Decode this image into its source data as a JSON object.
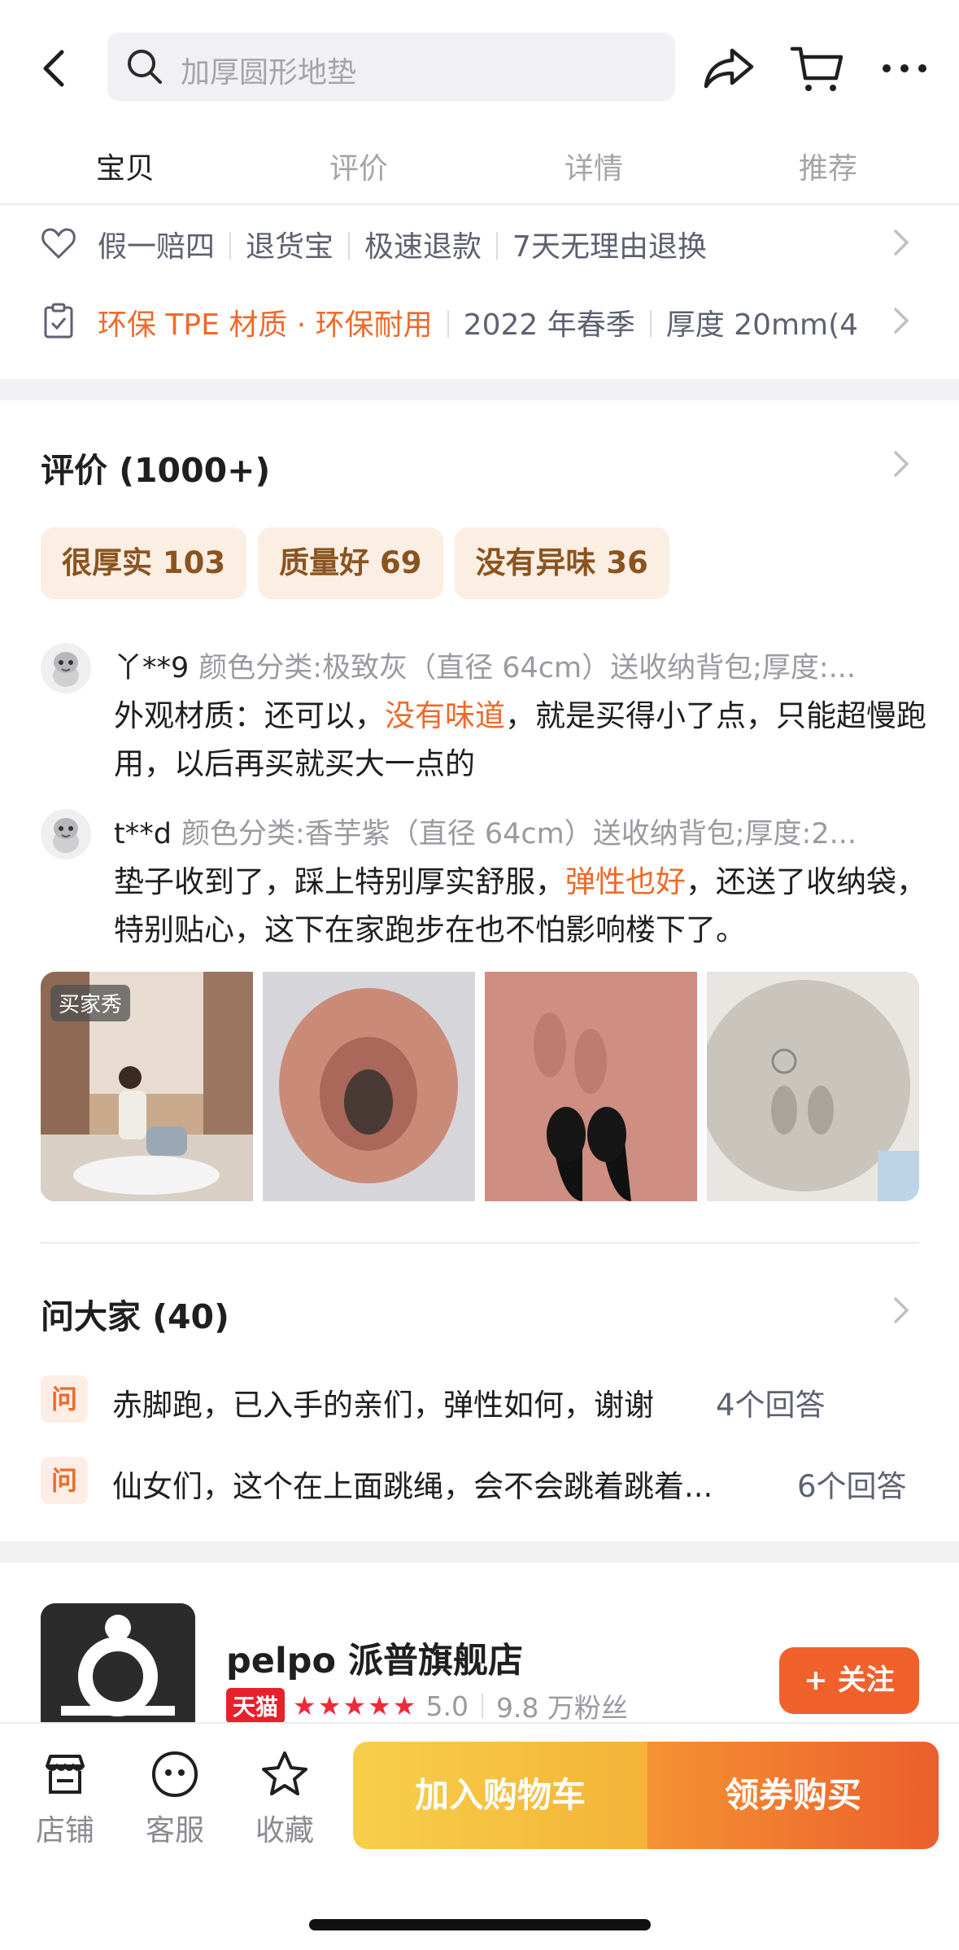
{
  "search": {
    "placeholder": "加厚圆形地垫"
  },
  "tabs": [
    {
      "label": "宝贝",
      "active": true
    },
    {
      "label": "评价",
      "active": false
    },
    {
      "label": "详情",
      "active": false
    },
    {
      "label": "推荐",
      "active": false
    }
  ],
  "services": {
    "guarantee": [
      "假一赔四",
      "退货宝",
      "极速退款",
      "7天无理由退换"
    ],
    "params": [
      "环保 TPE 材质 · 环保耐用",
      "2022 年春季",
      "厚度 20mm(4"
    ]
  },
  "reviews": {
    "title": "评价 (1000+)",
    "tags": [
      "很厚实 103",
      "质量好 69",
      "没有异味 36"
    ],
    "items": [
      {
        "user": "丫**9",
        "spec": "颜色分类:极致灰（直径 64cm）送收纳背包;厚度:...",
        "text_before": "外观材质：还可以，",
        "highlight": "没有味道",
        "text_after": "，就是买得小了点，只能超慢跑用，以后再买就买大一点的"
      },
      {
        "user": "t**d",
        "spec": "颜色分类:香芋紫（直径 64cm）送收纳背包;厚度:2...",
        "text_before": "垫子收到了，踩上特别厚实舒服，",
        "highlight": "弹性也好",
        "text_after": "，还送了收纳袋，特别贴心，这下在家跑步在也不怕影响楼下了。"
      }
    ],
    "photo_badge": "买家秀"
  },
  "qa": {
    "title": "问大家 (40)",
    "badge": "问",
    "items": [
      {
        "question": "赤脚跑，已入手的亲们，弹性如何，谢谢",
        "answers": "4个回答"
      },
      {
        "question": "仙女们，这个在上面跳绳，会不会跳着跳着...",
        "answers": "6个回答"
      }
    ]
  },
  "store": {
    "name": "pelpo 派普旗舰店",
    "platform": "天猫",
    "stars": "★★★★★",
    "rating": "5.0",
    "fans": "9.8 万粉丝",
    "follow_label": "+ 关注"
  },
  "bottom_bar": {
    "shop": "店铺",
    "service": "客服",
    "favorite": "收藏",
    "add_to_cart": "加入购物车",
    "buy": "领券购买"
  },
  "colors": {
    "accent": "#ee6a2a",
    "tmall_red": "#e8202c",
    "cart_yellow": "#f4b338",
    "buy_orange": "#ec5e2c"
  }
}
